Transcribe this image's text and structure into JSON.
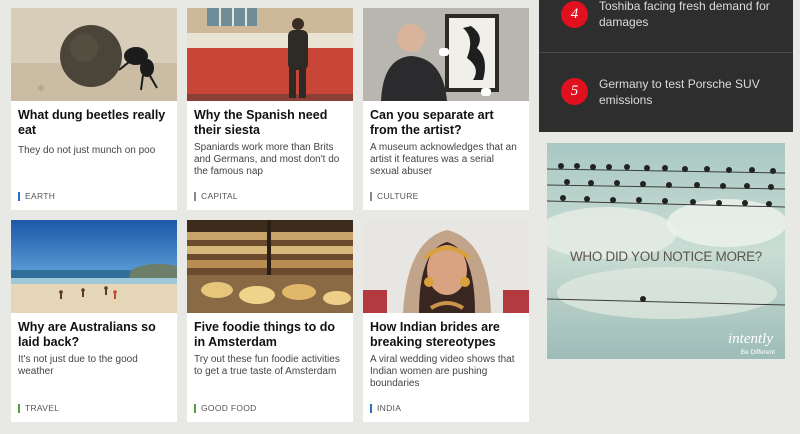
{
  "articles": [
    {
      "title": "What dung beetles really eat",
      "summary": "They do not just munch on poo",
      "tag": "EARTH"
    },
    {
      "title": "Why the Spanish need their siesta",
      "summary": "Spaniards work more than Brits and Germans, and most don't do the famous nap",
      "tag": "CAPITAL"
    },
    {
      "title": "Can you separate art from the artist?",
      "summary": "A museum acknowledges that an artist it features was a serial sexual abuser",
      "tag": "CULTURE"
    },
    {
      "title": "Why are Australians so laid back?",
      "summary": "It's not just due to the good weather",
      "tag": "TRAVEL"
    },
    {
      "title": "Five foodie things to do in Amsterdam",
      "summary": "Try out these fun foodie activities to get a true taste of Amsterdam",
      "tag": "GOOD FOOD"
    },
    {
      "title": "How Indian brides are breaking stereotypes",
      "summary": "A viral wedding video shows that Indian women are pushing boundaries",
      "tag": "INDIA"
    }
  ],
  "most_read": [
    {
      "rank": "4",
      "headline": "Toshiba facing fresh demand for damages"
    },
    {
      "rank": "5",
      "headline": "Germany to test Porsche SUV emissions"
    }
  ],
  "ad": {
    "headline": "WHO DID YOU NOTICE MORE?",
    "brand": "intently",
    "tagline": "Be Different"
  },
  "colors": {
    "rank_badge": "#e0101e",
    "panel": "#2e2e2e",
    "tag_blue": "#2b72c6",
    "tag_green": "#4f9f3a"
  }
}
